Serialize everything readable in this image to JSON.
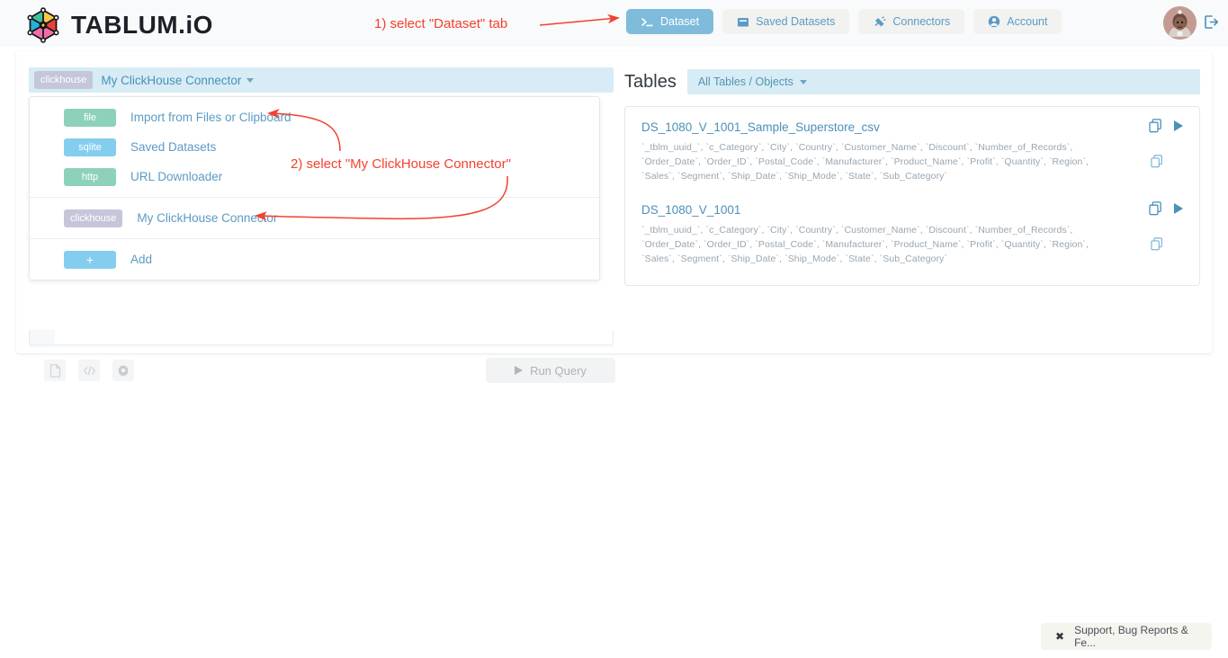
{
  "header": {
    "brand": "TABLUM.iO",
    "logo_icon": "hexagon-network-logo",
    "tabs": [
      {
        "label": "Dataset",
        "icon": "terminal-prompt-icon",
        "active": true
      },
      {
        "label": "Saved Datasets",
        "icon": "archive-box-icon",
        "active": false
      },
      {
        "label": "Connectors",
        "icon": "plug-icon",
        "active": false
      },
      {
        "label": "Account",
        "icon": "user-circle-icon",
        "active": false
      }
    ],
    "avatar_icon": "user-avatar",
    "logout_icon": "logout-icon"
  },
  "left_panel": {
    "connector_selector": {
      "badge": "clickhouse",
      "label": "My ClickHouse Connector",
      "caret_icon": "chevron-down-icon"
    },
    "dropdown_groups": [
      {
        "items": [
          {
            "badge": "file",
            "badge_class": "file",
            "label": "Import from Files or Clipboard"
          },
          {
            "badge": "sqlite",
            "badge_class": "sqlite",
            "label": "Saved Datasets"
          },
          {
            "badge": "http",
            "badge_class": "http",
            "label": "URL Downloader"
          }
        ]
      },
      {
        "items": [
          {
            "badge": "clickhouse",
            "badge_class": "clickhouse",
            "label": "My ClickHouse Connector"
          }
        ]
      },
      {
        "items": [
          {
            "badge": "+",
            "badge_class": "add",
            "label": "Add"
          }
        ]
      }
    ],
    "toolbar": [
      {
        "icon": "document-icon"
      },
      {
        "icon": "code-brackets-icon"
      },
      {
        "icon": "gear-icon"
      }
    ],
    "run_query": {
      "label": "Run Query",
      "icon": "play-icon"
    }
  },
  "right_panel": {
    "title": "Tables",
    "object_filter": {
      "label": "All Tables / Objects",
      "caret_icon": "chevron-down-icon"
    },
    "tables": [
      {
        "name": "DS_1080_V_1001_Sample_Superstore_csv",
        "columns": "`_tblm_uuid_`, `c_Category`, `City`, `Country`, `Customer_Name`, `Discount`, `Number_of_Records`, `Order_Date`, `Order_ID`, `Postal_Code`, `Manufacturer`, `Product_Name`, `Profit`, `Quantity`, `Region`, `Sales`, `Segment`, `Ship_Date`, `Ship_Mode`, `State`, `Sub_Category`",
        "copy_icon": "copy-icon",
        "run_icon": "play-icon"
      },
      {
        "name": "DS_1080_V_1001",
        "columns": "`_tblm_uuid_`, `c_Category`, `City`, `Country`, `Customer_Name`, `Discount`, `Number_of_Records`, `Order_Date`, `Order_ID`, `Postal_Code`, `Manufacturer`, `Product_Name`, `Profit`, `Quantity`, `Region`, `Sales`, `Segment`, `Ship_Date`, `Ship_Mode`, `State`, `Sub_Category`",
        "copy_icon": "copy-icon",
        "run_icon": "play-icon"
      }
    ]
  },
  "annotations": {
    "step1": "1) select \"Dataset\" tab",
    "step2": "2) select \"My ClickHouse Connector\"",
    "color": "#f4402e"
  },
  "support_banner": {
    "label": "Support, Bug Reports & Fe...",
    "close_icon": "close-x-icon"
  }
}
